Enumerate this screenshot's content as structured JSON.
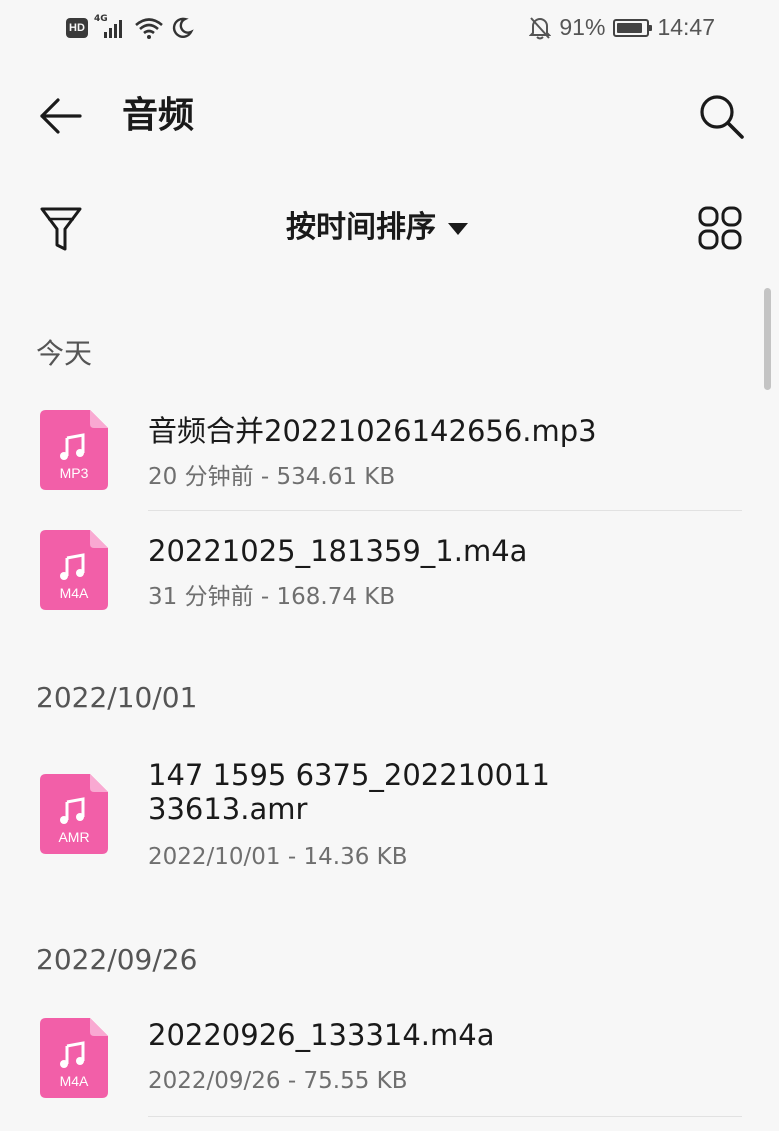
{
  "status_bar": {
    "hd": "HD",
    "network": "4G",
    "battery": "91%",
    "battery_level": 0.91,
    "time": "14:47",
    "icons": [
      "hd-icon",
      "signal-icon",
      "wifi-icon",
      "moon-icon",
      "mute-bell-icon",
      "battery-icon"
    ]
  },
  "header": {
    "title": "音频",
    "back_icon": "arrow-left-icon",
    "search_icon": "search-icon"
  },
  "toolbar": {
    "sort_label": "按时间排序",
    "filter_icon": "filter-icon",
    "grid_icon": "grid-view-icon"
  },
  "sections": [
    {
      "label": "今天",
      "files": [
        {
          "name": "音频合并20221026142656.mp3",
          "meta": "20 分钟前 - 534.61 KB",
          "type": "MP3"
        },
        {
          "name": "20221025_181359_1.m4a",
          "meta": "31 分钟前 - 168.74 KB",
          "type": "M4A"
        }
      ]
    },
    {
      "label": "2022/10/01",
      "files": [
        {
          "name": "147 1595 6375_20221001133613.amr",
          "meta": "2022/10/01 - 14.36 KB",
          "type": "AMR"
        }
      ]
    },
    {
      "label": "2022/09/26",
      "files": [
        {
          "name": "20220926_133314.m4a",
          "meta": "2022/09/26 - 75.55 KB",
          "type": "M4A"
        }
      ]
    }
  ],
  "colors": {
    "file_icon": "#f25fa8",
    "file_icon_fold": "#f9a9d2",
    "background": "#f7f7f7"
  }
}
